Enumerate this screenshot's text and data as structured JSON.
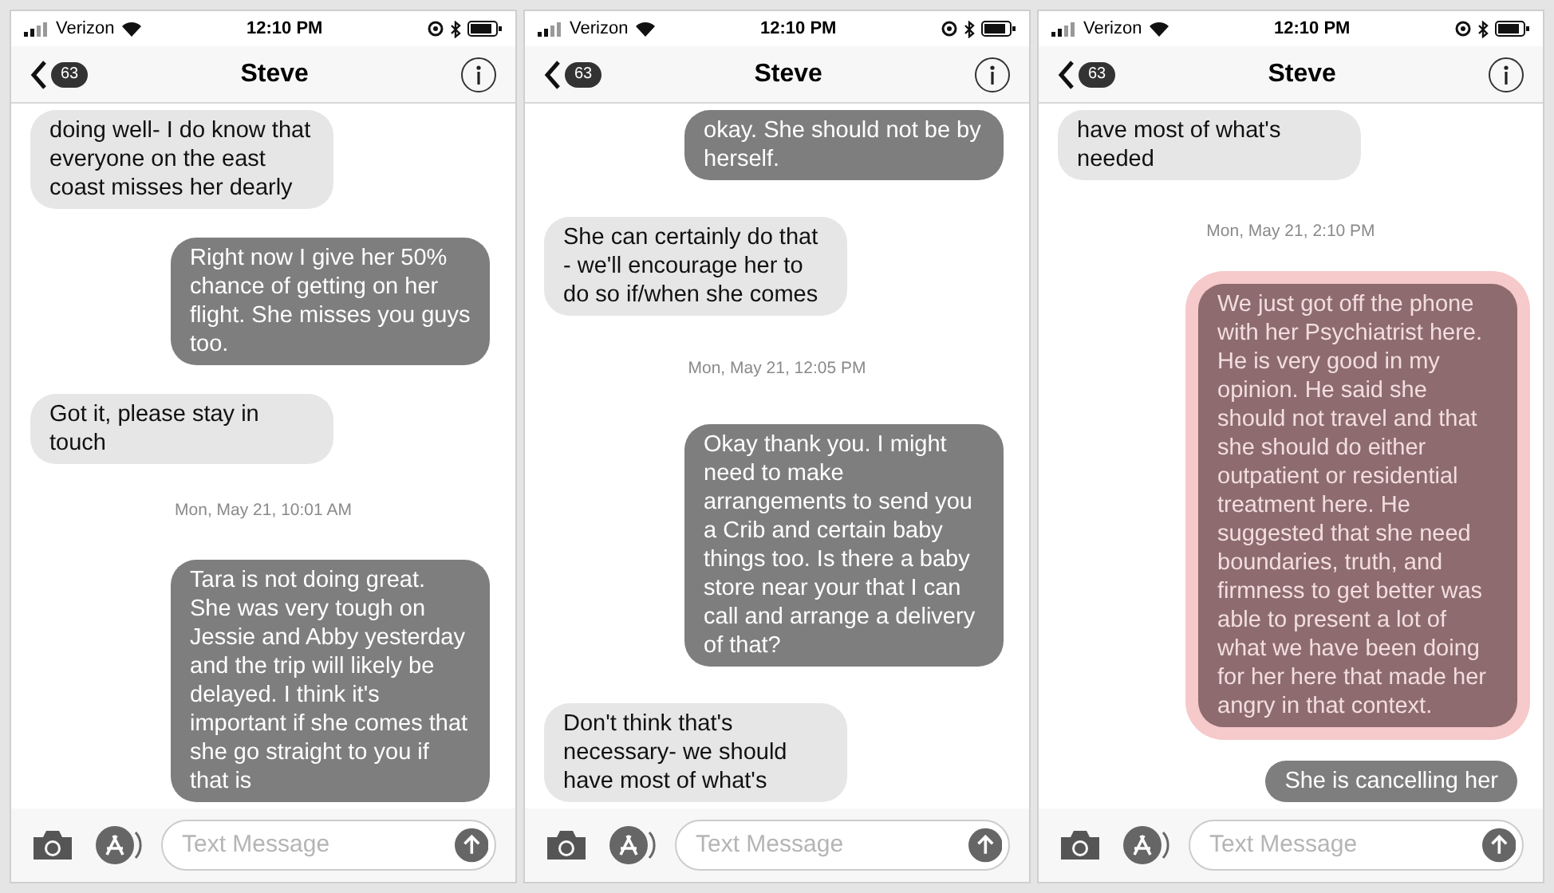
{
  "screens": [
    {
      "status_bar": {
        "carrier": "Verizon",
        "time": "12:10 PM"
      },
      "nav": {
        "badge": "63",
        "title": "Steve"
      },
      "messages": [
        {
          "kind": "incoming",
          "highlighted": false,
          "text": "doing well- I do know that everyone on the east coast misses her dearly"
        },
        {
          "kind": "outgoing",
          "highlighted": false,
          "text": "Right now I give her 50% chance of getting on her flight. She misses you guys too."
        },
        {
          "kind": "incoming",
          "highlighted": false,
          "text": "Got it, please stay in touch"
        },
        {
          "kind": "timestamp",
          "highlighted": false,
          "text": "Mon, May 21, 10:01 AM"
        },
        {
          "kind": "outgoing",
          "highlighted": false,
          "text": "Tara is not doing great. She was very tough on Jessie and Abby yesterday and the trip will likely be delayed. I think it's important if she comes that she go straight to you if that is"
        }
      ],
      "input": {
        "placeholder": "Text Message"
      }
    },
    {
      "status_bar": {
        "carrier": "Verizon",
        "time": "12:10 PM"
      },
      "nav": {
        "badge": "63",
        "title": "Steve"
      },
      "messages": [
        {
          "kind": "outgoing",
          "highlighted": false,
          "text": "okay. She should not be by herself."
        },
        {
          "kind": "incoming",
          "highlighted": false,
          "text": "She can certainly do that - we'll encourage her to do so if/when she comes"
        },
        {
          "kind": "timestamp",
          "highlighted": false,
          "text": "Mon, May 21, 12:05 PM"
        },
        {
          "kind": "outgoing",
          "highlighted": false,
          "text": "Okay thank you. I might need to make arrangements to send you a Crib and certain baby things too. Is there a baby store near your that I can call and arrange a delivery of that?"
        },
        {
          "kind": "incoming",
          "highlighted": false,
          "text": "Don't think that's necessary- we should have most of what's"
        }
      ],
      "input": {
        "placeholder": "Text Message"
      }
    },
    {
      "status_bar": {
        "carrier": "Verizon",
        "time": "12:10 PM"
      },
      "nav": {
        "badge": "63",
        "title": "Steve"
      },
      "messages": [
        {
          "kind": "incoming",
          "highlighted": false,
          "text": "have most of what's needed"
        },
        {
          "kind": "timestamp",
          "highlighted": false,
          "text": "Mon, May 21, 2:10 PM"
        },
        {
          "kind": "outgoing",
          "highlighted": true,
          "text": "We just got off the phone with her Psychiatrist here. He is very good in my opinion. He said she should not travel and that she should do either outpatient or residential treatment here. He suggested that she need boundaries, truth, and firmness to get better was able to present a lot of what we have been doing for her here that made her angry in that context."
        },
        {
          "kind": "outgoing",
          "highlighted": false,
          "text": "She is cancelling her"
        }
      ],
      "input": {
        "placeholder": "Text Message"
      }
    }
  ]
}
